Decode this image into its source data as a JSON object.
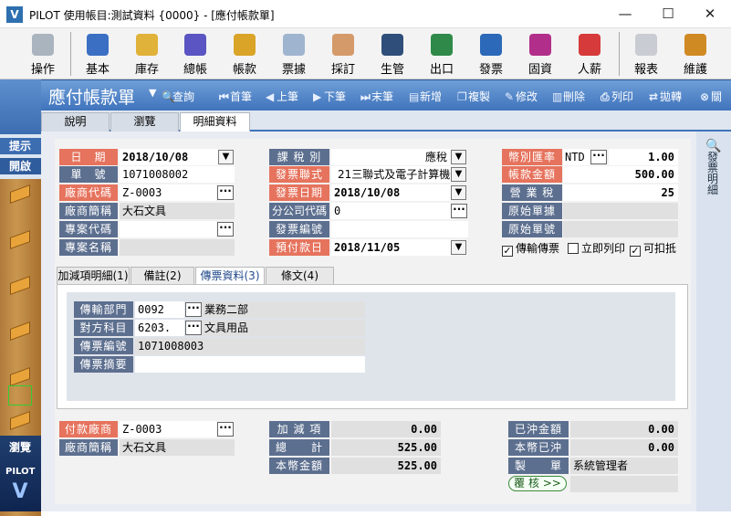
{
  "window": {
    "title": "PILOT  使用帳目:測試資料 {0000} - [應付帳款單]",
    "minimize": "—",
    "maximize": "☐",
    "close": "✕"
  },
  "toolbar": [
    {
      "label": "操作",
      "icon": "mouse-icon",
      "color": "#aab4bf"
    },
    {
      "label": "基本",
      "icon": "grid-icon",
      "color": "#3b6fc4"
    },
    {
      "label": "庫存",
      "icon": "bag-icon",
      "color": "#e0b23a"
    },
    {
      "label": "總帳",
      "icon": "book-icon",
      "color": "#5a55c2"
    },
    {
      "label": "帳款",
      "icon": "coins-icon",
      "color": "#d9a428"
    },
    {
      "label": "票據",
      "icon": "ticket-icon",
      "color": "#9fb4cf"
    },
    {
      "label": "採訂",
      "icon": "handshake-icon",
      "color": "#d59a6a"
    },
    {
      "label": "生管",
      "icon": "gear-icon",
      "color": "#2f4f7a"
    },
    {
      "label": "出口",
      "icon": "globe-icon",
      "color": "#2f8a4a"
    },
    {
      "label": "發票",
      "icon": "invoice-icon",
      "color": "#2c69b8"
    },
    {
      "label": "固資",
      "icon": "stairs-icon",
      "color": "#b12f8a"
    },
    {
      "label": "人薪",
      "icon": "chart-icon",
      "color": "#d63a3a"
    },
    {
      "label": "報表",
      "icon": "report-icon",
      "color": "#c9ccd2"
    },
    {
      "label": "維護",
      "icon": "wrench-icon",
      "color": "#d08a24"
    }
  ],
  "command_bar": {
    "title": "應付帳款單",
    "dropdown": "▼",
    "buttons": [
      {
        "label": "查詢",
        "glyph": "🔍"
      },
      {
        "label": "首筆",
        "glyph": "⏮"
      },
      {
        "label": "上筆",
        "glyph": "◀"
      },
      {
        "label": "下筆",
        "glyph": "▶"
      },
      {
        "label": "末筆",
        "glyph": "⏭"
      },
      {
        "label": "新增",
        "glyph": "▤"
      },
      {
        "label": "複製",
        "glyph": "❐"
      },
      {
        "label": "修改",
        "glyph": "✎"
      },
      {
        "label": "刪除",
        "glyph": "▥"
      },
      {
        "label": "列印",
        "glyph": "⎙"
      },
      {
        "label": "拋轉",
        "glyph": "⇄"
      },
      {
        "label": "關",
        "glyph": "⊗"
      }
    ]
  },
  "sidebar": {
    "hint": "提示",
    "open": "開啟",
    "browse": "瀏覽",
    "brand": "PILOT"
  },
  "tabs": [
    {
      "label": "說明"
    },
    {
      "label": "瀏覽"
    },
    {
      "label": "明細資料"
    }
  ],
  "right_panel": {
    "label": "發票明細"
  },
  "form": {
    "date_label": "日　期",
    "date": "2018/10/08",
    "no_label": "單　號",
    "no": "1071008002",
    "vendor_code_label": "廠商代碼",
    "vendor_code": "Z-0003",
    "vendor_name_label": "廠商簡稱",
    "vendor_name": "大石文具",
    "project_code_label": "專案代碼",
    "project_code": "",
    "project_name_label": "專案名稱",
    "project_name": "",
    "tax_type_label": "課 稅 別",
    "tax_type": "應稅",
    "invoice_type_label": "發票聯式",
    "invoice_type": "21三聯式及電子計算機",
    "invoice_date_label": "發票日期",
    "invoice_date": "2018/10/08",
    "branch_label": "分公司代碼",
    "branch": "0",
    "invoice_no_label": "發票編號",
    "invoice_no": "",
    "pay_date_label": "預付款日",
    "pay_date": "2018/11/05",
    "currency_label": "幣別匯率",
    "currency": "NTD",
    "rate": "1.00",
    "amount_label": "帳款金額",
    "amount": "500.00",
    "tax_label": "營 業 稅",
    "tax": "25",
    "orig_doc_label": "原始單據",
    "orig_doc": "",
    "orig_no_label": "原始單號",
    "orig_no": "",
    "cb_transfer": "傳輸傳票",
    "cb_print": "立即列印",
    "cb_deduct": "可扣抵"
  },
  "inner_tabs": [
    {
      "label": "加減項明細(1)"
    },
    {
      "label": "備註(2)"
    },
    {
      "label": "傳票資料(3)"
    },
    {
      "label": "條文(4)"
    }
  ],
  "voucher": {
    "dept_label": "傳輸部門",
    "dept_code": "0092",
    "dept_name": "業務二部",
    "acct_label": "對方科目",
    "acct_code": "6203.",
    "acct_name": "文具用品",
    "vno_label": "傳票編號",
    "vno": "1071008003",
    "memo_label": "傳票摘要",
    "memo": ""
  },
  "footer": {
    "pay_vendor_label": "付款廠商",
    "pay_vendor": "Z-0003",
    "pay_vendor_name_label": "廠商簡稱",
    "pay_vendor_name": "大石文具",
    "adj_label": "加 減 項",
    "adj": "0.00",
    "total_label": "總　　計",
    "total": "525.00",
    "local_label": "本幣金額",
    "local": "525.00",
    "offset_label": "已沖金額",
    "offset": "0.00",
    "local_offset_label": "本幣已沖",
    "local_offset": "0.00",
    "maker_label": "製　　單",
    "maker": "系統管理者",
    "review_btn": "覆 核 >>"
  }
}
